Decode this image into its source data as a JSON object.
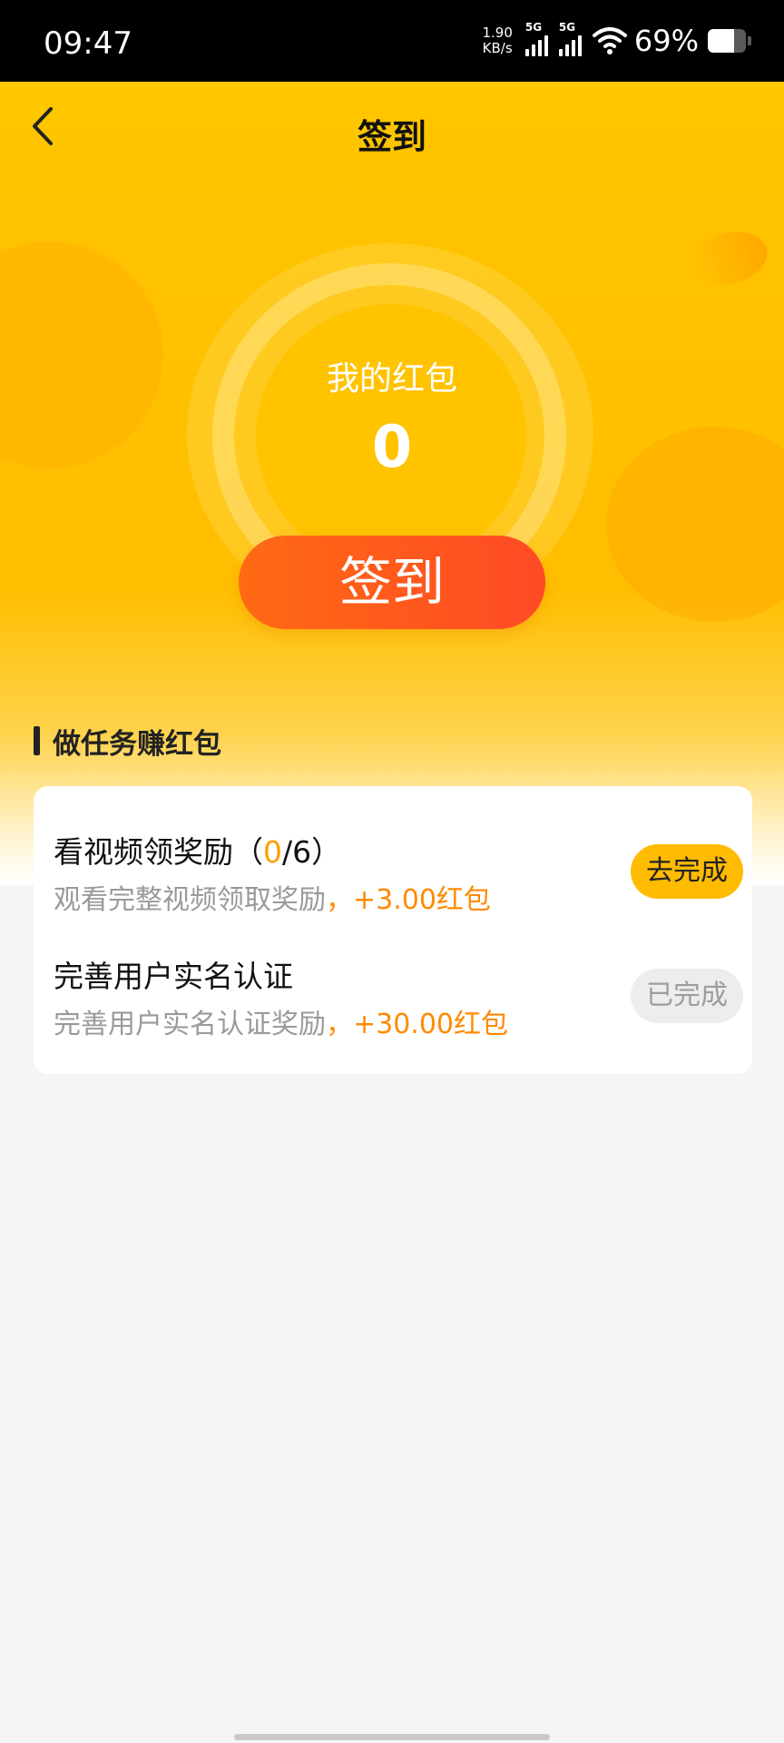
{
  "status_bar": {
    "time": "09:47",
    "net_speed_value": "1.90",
    "net_speed_unit": "KB/s",
    "signal1_label": "5G",
    "signal2_label": "5G",
    "battery_percent": "69%",
    "battery_level": 0.69,
    "icons": [
      "signal-icon",
      "wifi-icon",
      "battery-icon"
    ]
  },
  "nav": {
    "back_icon": "chevron-left-icon",
    "title": "签到"
  },
  "wallet": {
    "label": "我的红包",
    "value": "0"
  },
  "sign_button": "签到",
  "section": {
    "title": "做任务赚红包"
  },
  "tasks": [
    {
      "title_prefix": "看视频领奖励（",
      "progress_current": "0",
      "progress_rest": "/6）",
      "desc_prefix": "观看完整视频领取奖励",
      "desc_reward": "，+3.00红包",
      "button": "去完成"
    },
    {
      "title": "完善用户实名认证",
      "desc_prefix": "完善用户实名认证奖励",
      "desc_reward": "，+30.00红包",
      "button": "已完成"
    }
  ],
  "colors": {
    "brand_yellow": "#ffc300",
    "button_orange": "#ff5a1e",
    "reward_orange": "#ff8a00",
    "done_gray": "#ededed"
  }
}
